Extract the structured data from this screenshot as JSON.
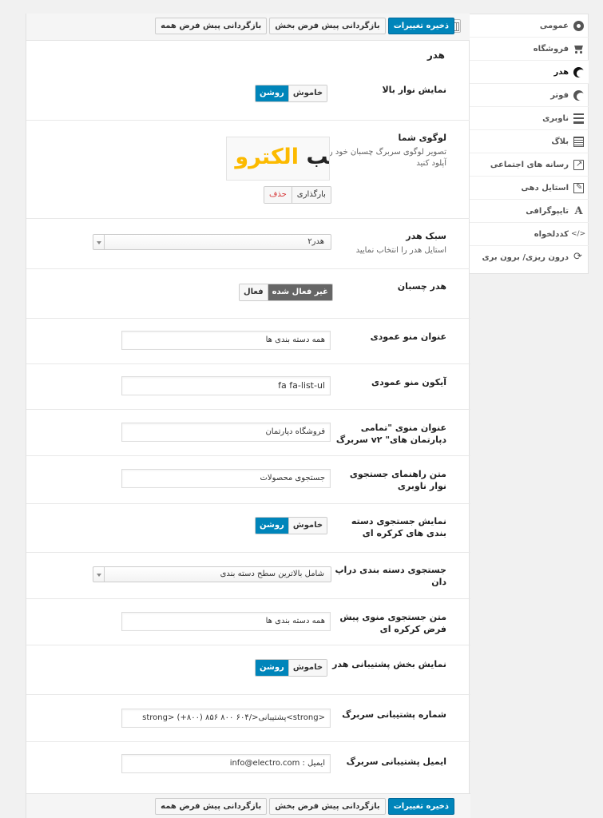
{
  "toolbar": {
    "save": "ذخیره تغییرات",
    "reset_section": "بازگردانی پیش فرض بخش",
    "reset_all": "بازگردانی پیش فرض همه"
  },
  "section_title": "هدر",
  "sidebar": {
    "items": [
      {
        "label": "عمومی",
        "icon": "circle-icon"
      },
      {
        "label": "فروشگاه",
        "icon": "cart-icon"
      },
      {
        "label": "هدر",
        "icon": "arrow-up-circle-icon"
      },
      {
        "label": "فوتر",
        "icon": "arrow-up-circle-icon"
      },
      {
        "label": "ناوبری",
        "icon": "menu-icon"
      },
      {
        "label": "بلاگ",
        "icon": "grid-icon"
      },
      {
        "label": "رسانه های اجتماعی",
        "icon": "share-icon"
      },
      {
        "label": "استایل دهی",
        "icon": "edit-icon"
      },
      {
        "label": "تایپوگرافی",
        "icon": "typography-icon"
      },
      {
        "label": "کددلخواه",
        "icon": "code-icon"
      },
      {
        "label": "درون ریزی/ برون بری",
        "icon": "sync-icon"
      }
    ]
  },
  "fields": {
    "topbar": {
      "label": "نمایش نوار بالا",
      "off": "خاموش",
      "on": "روشن"
    },
    "logo": {
      "label": "لوگوی شما",
      "desc": "تصویر لوگوی سربرگ چسبان خود را آپلود کنید",
      "logo_black": "قالب",
      "logo_yellow": "الکترو",
      "upload": "بارگذاری",
      "remove": "حذف"
    },
    "header_style": {
      "label": "سبک هدر",
      "desc": "استایل هدر را انتخاب نمایید",
      "value": "هدر۲"
    },
    "sticky": {
      "label": "هدر چسبان",
      "disabled": "غیر فعال شده",
      "enabled": "فعال"
    },
    "vmenu_title": {
      "label": "عنوان منو عمودی",
      "value": "همه دسته بندی ها"
    },
    "vmenu_icon": {
      "label": "آیکون منو عمودی",
      "value": "fa fa-list-ul"
    },
    "dept_title": {
      "label": "عنوان منوی \"تمامی دپارتمان های\" v۲ سربرگ",
      "value": "فروشگاه دپارتمان"
    },
    "search_placeholder": {
      "label": "متن راهنمای جستجوی نوار ناوبری",
      "value": "جستجوی محصولات"
    },
    "cat_search": {
      "label": "نمایش جستجوی دسته بندی های کرکره ای",
      "off": "خاموش",
      "on": "روشن"
    },
    "cat_dropdown": {
      "label": "جستجوی دسته بندی دراپ دان",
      "value": "شامل بالاترین سطح دسته بندی"
    },
    "default_search_text": {
      "label": "متن جستجوی منوی پیش فرض کرکره ای",
      "value": "همه دسته بندی ها"
    },
    "support_block": {
      "label": "نمایش بخش پشتیبانی هدر",
      "off": "خاموش",
      "on": "روشن"
    },
    "support_phone": {
      "label": "شماره پشتیبانی سربرگ",
      "value": "<strong>پشتیبانی</strong> (+۸۰۰) ۸۵۶ ۸۰۰ ۶۰۴"
    },
    "support_email": {
      "label": "ایمیل پشتیبانی سربرگ",
      "value": "ایمیل : info@electro.com"
    }
  }
}
